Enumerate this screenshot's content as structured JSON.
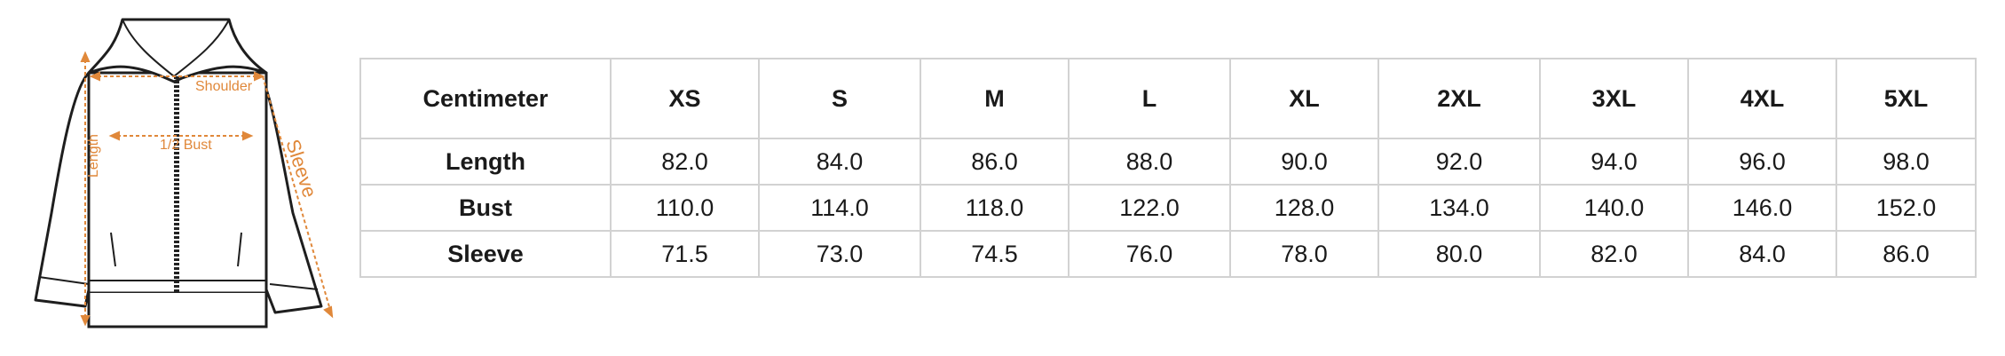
{
  "diagram": {
    "labels": {
      "shoulder": "Shoulder",
      "bust": "1/2 Bust",
      "length": "Length",
      "sleeve": "Sleeve"
    },
    "accent_color": "#e0883a"
  },
  "size_table": {
    "header": [
      "Centimeter",
      "XS",
      "S",
      "M",
      "L",
      "XL",
      "2XL",
      "3XL",
      "4XL",
      "5XL"
    ],
    "rows": [
      {
        "label": "Length",
        "values": [
          "82.0",
          "84.0",
          "86.0",
          "88.0",
          "90.0",
          "92.0",
          "94.0",
          "96.0",
          "98.0"
        ]
      },
      {
        "label": "Bust",
        "values": [
          "110.0",
          "114.0",
          "118.0",
          "122.0",
          "128.0",
          "134.0",
          "140.0",
          "146.0",
          "152.0"
        ]
      },
      {
        "label": "Sleeve",
        "values": [
          "71.5",
          "73.0",
          "74.5",
          "76.0",
          "78.0",
          "80.0",
          "82.0",
          "84.0",
          "86.0"
        ]
      }
    ]
  }
}
